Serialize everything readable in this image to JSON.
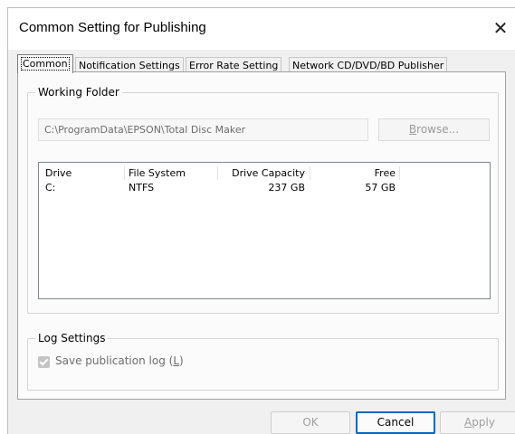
{
  "window": {
    "title": "Common Setting for Publishing",
    "close_glyph": "✕"
  },
  "tabs": [
    {
      "label": "Common",
      "active": true
    },
    {
      "label": "Notification Settings",
      "active": false
    },
    {
      "label": "Error Rate Setting",
      "active": false
    },
    {
      "label": "Network CD/DVD/BD Publisher",
      "active": false
    }
  ],
  "working_folder": {
    "group_title": "Working Folder",
    "path": "C:\\ProgramData\\EPSON\\Total Disc Maker",
    "browse_label_accel": "B",
    "browse_label_rest": "rowse...",
    "drives": {
      "columns": [
        "Drive",
        "File System",
        "Drive Capacity",
        "Free"
      ],
      "rows": [
        [
          "C:",
          "NTFS",
          "237 GB",
          "57 GB"
        ]
      ]
    }
  },
  "log_settings": {
    "group_title": "Log Settings",
    "save_log_label_pre": "Save publication log (",
    "save_log_accel": "L",
    "save_log_label_post": ")",
    "save_log_checked": true
  },
  "buttons": {
    "ok": "OK",
    "cancel": "Cancel",
    "apply_accel": "A",
    "apply_rest": "pply"
  },
  "icons": {
    "close": "close-icon",
    "check": "checkmark-icon"
  },
  "colors": {
    "accent": "#0067c0",
    "window_bg": "#f0f0f0",
    "page_bg": "#fbfbfb"
  }
}
